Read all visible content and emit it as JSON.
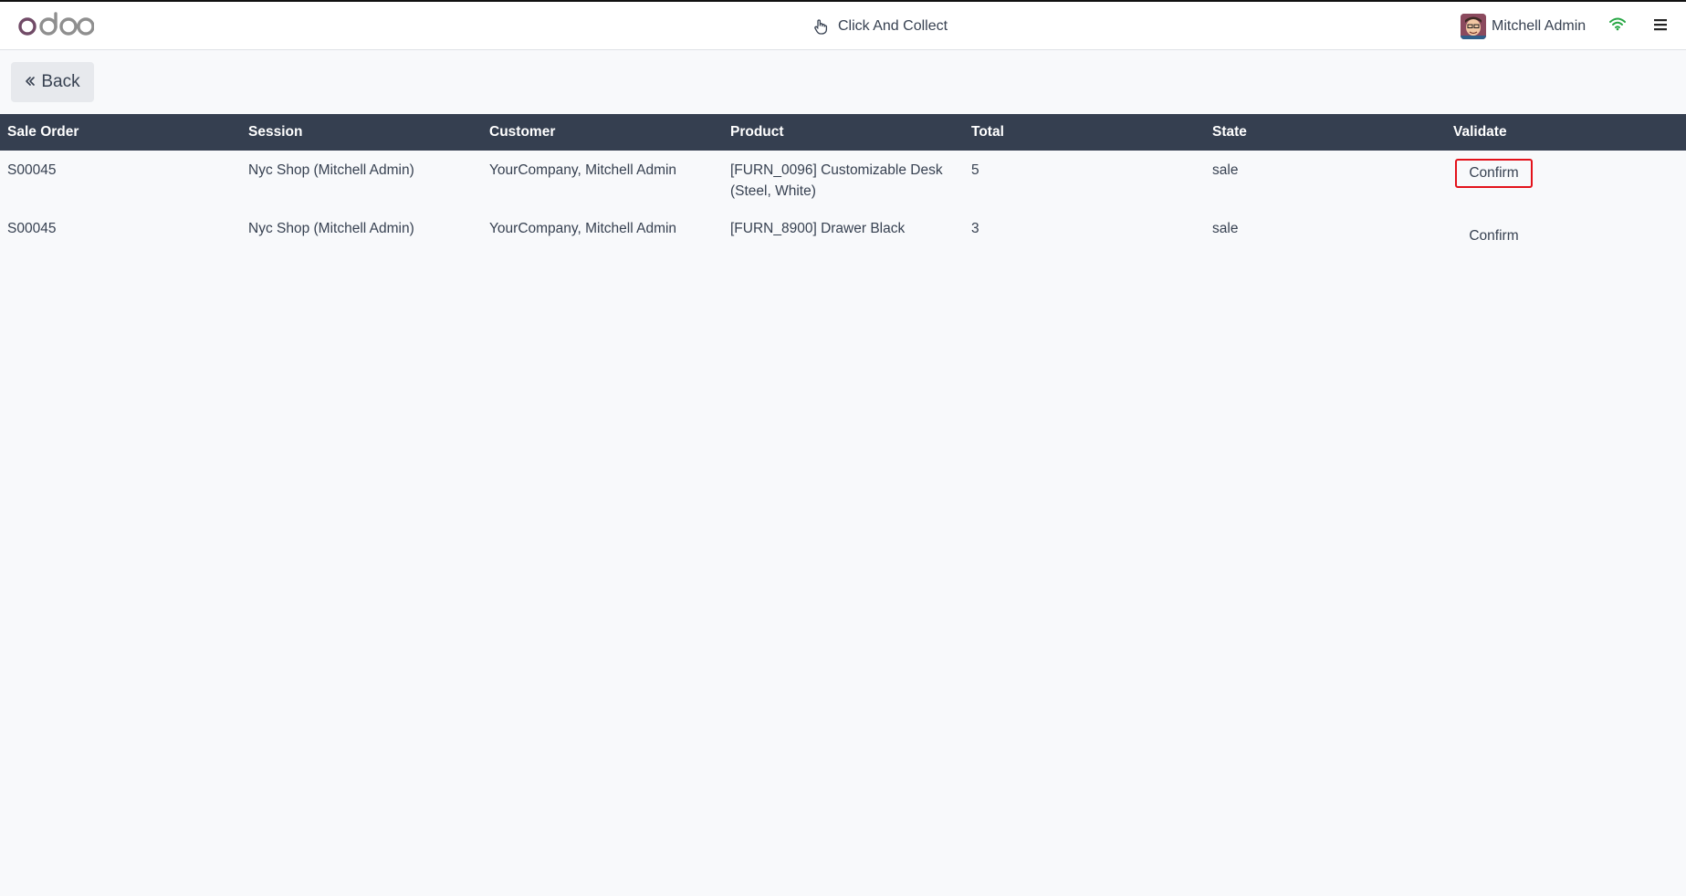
{
  "header": {
    "app_title": "Click And Collect",
    "user_name": "Mitchell Admin",
    "logo_text": "odoo",
    "icons": {
      "title_icon": "hand-pointer-icon",
      "connection_icon": "wifi-icon",
      "menu_icon": "hamburger-menu-icon"
    },
    "colors": {
      "wifi": "#28a745",
      "logo": "#714b67"
    }
  },
  "toolbar": {
    "back_label": "Back"
  },
  "table": {
    "columns": [
      "Sale Order",
      "Session",
      "Customer",
      "Product",
      "Total",
      "State",
      "Validate"
    ],
    "rows": [
      {
        "sale_order": "S00045",
        "session": "Nyc Shop (Mitchell Admin)",
        "customer": "YourCompany, Mitchell Admin",
        "product": "[FURN_0096] Customizable Desk (Steel, White)",
        "total": "5",
        "state": "sale",
        "action": "Confirm"
      },
      {
        "sale_order": "S00045",
        "session": "Nyc Shop (Mitchell Admin)",
        "customer": "YourCompany, Mitchell Admin",
        "product": "[FURN_8900] Drawer Black",
        "total": "3",
        "state": "sale",
        "action": "Confirm"
      }
    ]
  },
  "colors": {
    "header_bg": "#353f50",
    "highlight": "#e3121b",
    "page_bg": "#f8f9fb"
  }
}
